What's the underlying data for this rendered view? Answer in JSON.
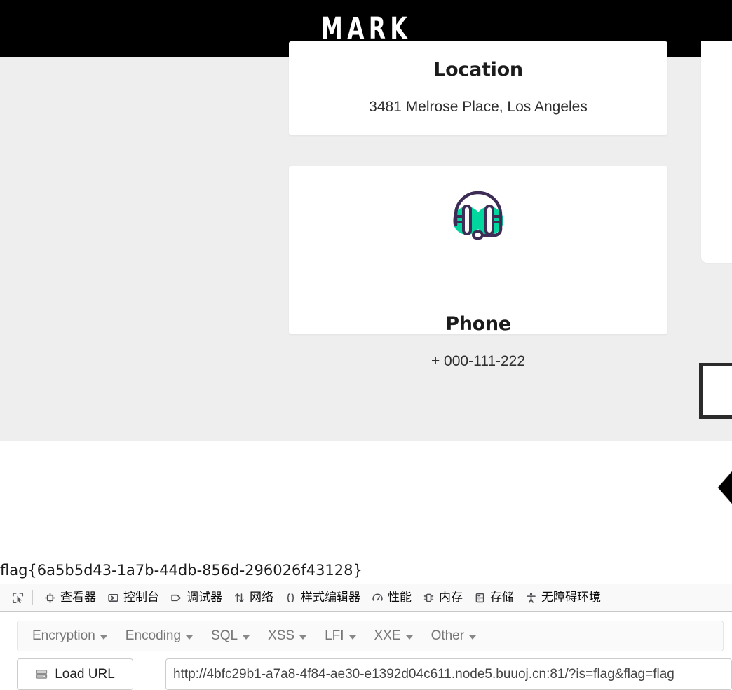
{
  "site": {
    "brand": "MARK",
    "header_bg": "#000000",
    "band_bg": "#eeeeee"
  },
  "cards": [
    {
      "name": "location",
      "title": "Location",
      "text": "3481 Melrose Place, Los Angeles"
    },
    {
      "name": "phone",
      "title": "Phone",
      "text": "+ 000-111-222",
      "icon": "headset-icon",
      "icon_fill": "#00d79f",
      "icon_stroke": "#3d2c55"
    }
  ],
  "carousel": {
    "prev_arrow_icon": "triangle-left-icon"
  },
  "flag": {
    "text": "flag{6a5b5d43-1a7b-44db-856d-296026f43128}"
  },
  "devtools": {
    "picker_icon": "element-picker-icon",
    "tabs": [
      {
        "label": "查看器",
        "icon": "inspector-icon"
      },
      {
        "label": "控制台",
        "icon": "console-icon"
      },
      {
        "label": "调试器",
        "icon": "debugger-icon"
      },
      {
        "label": "网络",
        "icon": "network-icon"
      },
      {
        "label": "样式编辑器",
        "icon": "style-editor-icon"
      },
      {
        "label": "性能",
        "icon": "performance-icon"
      },
      {
        "label": "内存",
        "icon": "memory-icon"
      },
      {
        "label": "存储",
        "icon": "storage-icon"
      },
      {
        "label": "无障碍环境",
        "icon": "accessibility-icon"
      }
    ]
  },
  "hackbar": {
    "menu": [
      {
        "label": "Encryption"
      },
      {
        "label": "Encoding"
      },
      {
        "label": "SQL"
      },
      {
        "label": "XSS"
      },
      {
        "label": "LFI"
      },
      {
        "label": "XXE"
      },
      {
        "label": "Other"
      }
    ],
    "load_url_label": "Load URL",
    "load_url_icon": "server-icon",
    "url_value": "http://4bfc29b1-a7a8-4f84-ae30-e1392d04c611.node5.buuoj.cn:81/?is=flag&flag=flag"
  }
}
